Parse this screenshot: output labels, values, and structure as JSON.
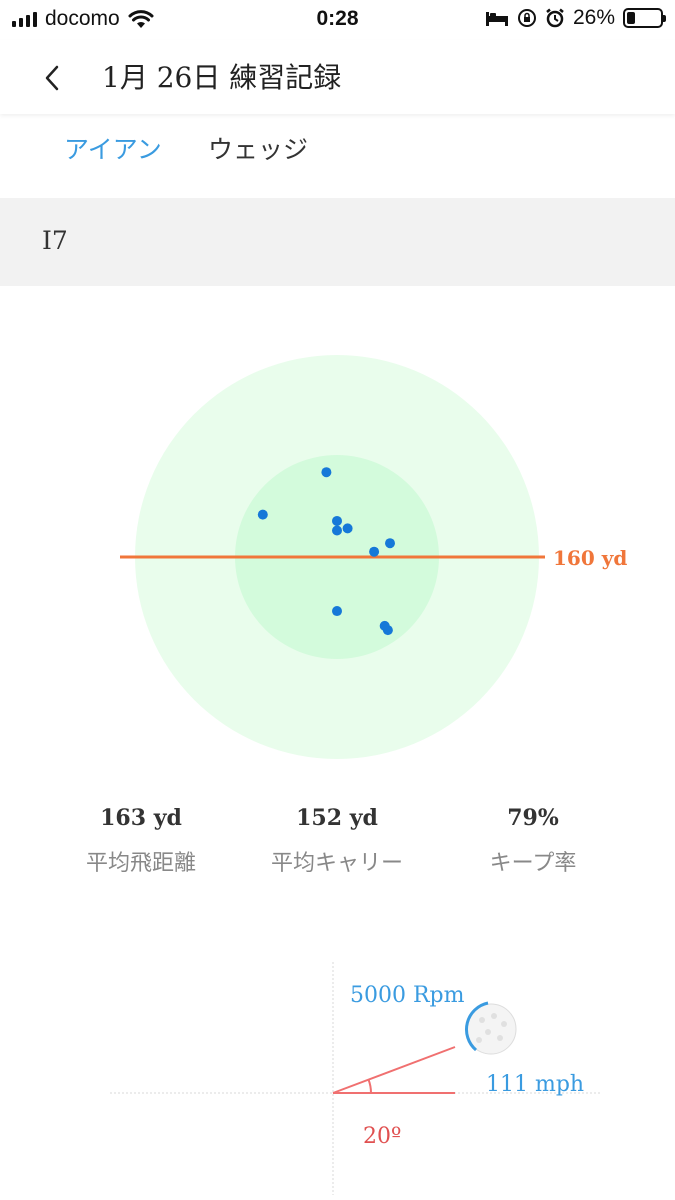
{
  "status_bar": {
    "carrier": "docomo",
    "time": "0:28",
    "battery_percent": "26%",
    "battery_level": 0.26,
    "icons": [
      "signal-icon",
      "wifi-icon",
      "bed-icon",
      "rotation-lock-icon",
      "alarm-icon",
      "battery-icon"
    ]
  },
  "nav": {
    "title": "1月 26日 練習記録"
  },
  "tabs": [
    {
      "label": "アイアン",
      "active": true
    },
    {
      "label": "ウェッジ",
      "active": false
    }
  ],
  "club": {
    "name": "I7"
  },
  "chart_data": {
    "type": "scatter",
    "target_label": "160 yd",
    "target_distance": 160,
    "points": [
      {
        "x": -1,
        "y": 8
      },
      {
        "x": -7,
        "y": 4
      },
      {
        "x": 0,
        "y": 3.4
      },
      {
        "x": 1,
        "y": 2.7
      },
      {
        "x": 0,
        "y": 2.5
      },
      {
        "x": 5,
        "y": 1.3
      },
      {
        "x": 3.5,
        "y": 0.5
      },
      {
        "x": 0,
        "y": -5.1
      },
      {
        "x": 4.5,
        "y": -6.5
      },
      {
        "x": 4.8,
        "y": -6.9
      }
    ],
    "colors": {
      "point": "#1678d8",
      "target_line": "#f0763a",
      "inner_circle": "#d3fbdc",
      "outer_circle": "#e9fdec"
    }
  },
  "stats": [
    {
      "value": "163 yd",
      "label": "平均飛距離"
    },
    {
      "value": "152 yd",
      "label": "平均キャリー"
    },
    {
      "value": "79%",
      "label": "キープ率"
    }
  ],
  "launch": {
    "spin": "5000 Rpm",
    "speed": "111 mph",
    "angle": "20º",
    "colors": {
      "blue_text": "#3a9be0",
      "angle_text": "#e05050",
      "lines": "#f07070"
    }
  },
  "colors": {
    "accent": "#3a9be0",
    "header_bg": "#f2f2f2"
  }
}
